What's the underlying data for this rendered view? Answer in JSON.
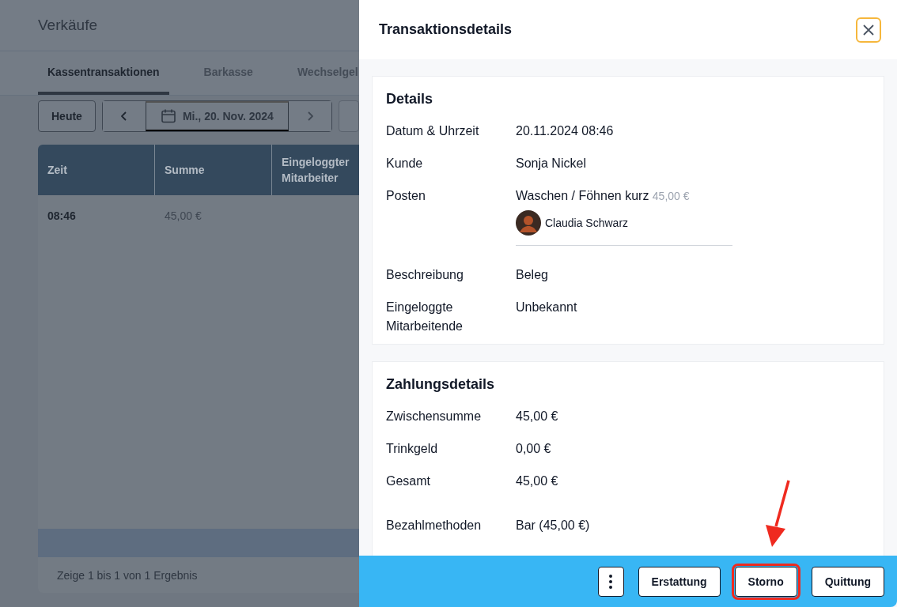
{
  "page": {
    "title": "Verkäufe",
    "tabs": [
      {
        "label": "Kassentransaktionen",
        "selected": true
      },
      {
        "label": "Barkasse",
        "selected": false
      },
      {
        "label": "Wechselgel",
        "selected": false
      }
    ],
    "toolbar": {
      "today_button": "Heute",
      "date": "Mi., 20. Nov. 2024"
    },
    "table": {
      "columns": [
        "Zeit",
        "Summe",
        "Eingeloggter Mitarbeiter"
      ],
      "rows": [
        {
          "cells": [
            "08:46",
            "45,00 €"
          ]
        }
      ],
      "footer": "Zeige 1 bis 1 von 1 Ergebnis"
    }
  },
  "drawer": {
    "title": "Transaktionsdetails",
    "sections": [
      {
        "title": "Details",
        "rows": [
          {
            "kind": "text",
            "label": "Datum & Uhrzeit",
            "value": "20.11.2024 08:46"
          },
          {
            "kind": "text",
            "label": "Kunde",
            "value": "Sonja Nickel"
          },
          {
            "kind": "item",
            "label": "Posten",
            "value": "Waschen / Föhnen kurz",
            "price": "45,00 €",
            "staff": "Claudia Schwarz"
          },
          {
            "kind": "text",
            "label": "Beschreibung",
            "value": "Beleg"
          },
          {
            "kind": "text",
            "label": "Eingeloggte Mitarbeitende",
            "value": "Unbekannt"
          }
        ]
      },
      {
        "title": "Zahlungsdetails",
        "rows": [
          {
            "kind": "text",
            "label": "Zwischensumme",
            "value": "45,00 €"
          },
          {
            "kind": "text",
            "label": "Trinkgeld",
            "value": "0,00 €"
          },
          {
            "kind": "text",
            "label": "Gesamt",
            "value": "45,00 €"
          },
          {
            "kind": "spaced",
            "label": "Bezahlmethoden",
            "value": "Bar (45,00 €)"
          }
        ]
      }
    ],
    "buttons": [
      {
        "kind": "more",
        "highlighted": false
      },
      {
        "kind": "text",
        "label": "Erstattung",
        "highlighted": false
      },
      {
        "kind": "text",
        "label": "Storno",
        "highlighted": true
      },
      {
        "kind": "text",
        "label": "Quittung",
        "highlighted": false
      }
    ]
  }
}
